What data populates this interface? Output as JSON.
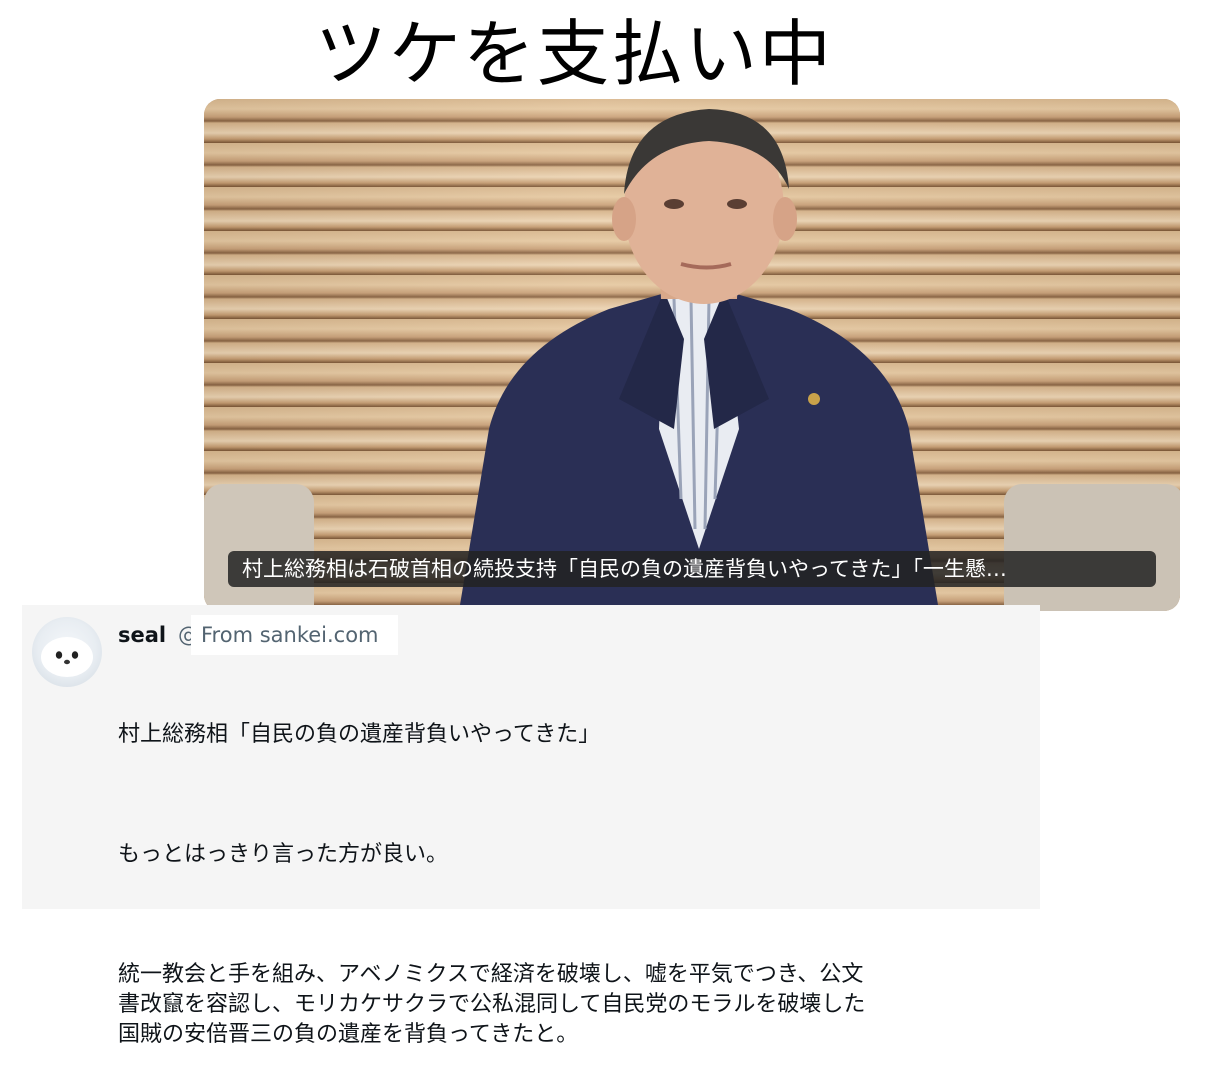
{
  "headline": "ツケを支払い中",
  "link_card": {
    "caption": "村上総務相は石破首相の続投支持「自民の負の遺産背負いやってきた」「一生懸…",
    "from_label": "From sankei.com"
  },
  "post": {
    "username": "seal",
    "handle_partial": "@",
    "paragraphs": [
      "村上総務相「自民の負の遺産背負いやってきた」",
      "もっとはっきり言った方が良い。",
      "統一教会と手を組み、アベノミクスで経済を破壊し、嘘を平気でつき、公文\n書改竄を容認し、モリカケサクラで公私混同して自民党のモラルを破壊した\n国賊の安倍晋三の負の遺産を背負ってきたと。"
    ]
  },
  "colors": {
    "caption_bg": "#222222",
    "post_bg": "#f5f5f5",
    "secondary_text": "#536471"
  }
}
